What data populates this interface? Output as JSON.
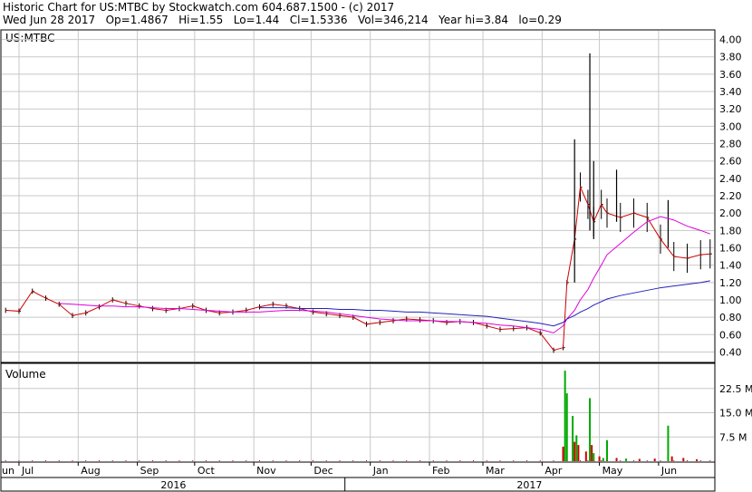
{
  "header": {
    "line1": "Historic Chart for US:MTBC by Stockwatch.com 604.687.1500 - (c) 2017",
    "line2": "Wed Jun 28 2017   Op=1.4867   Hi=1.55   Lo=1.44   Cl=1.5336   Vol=346,214   Year hi=3.84   lo=0.29"
  },
  "colors": {
    "price_bars": "#000000",
    "close_line": "#cc0000",
    "ma_short": "#dd00dd",
    "ma_long": "#2222bb",
    "volume_up": "#00aa00",
    "volume_down": "#cc0000",
    "grid": "#c8c8c8"
  },
  "chart_data": [
    {
      "type": "line",
      "title": "US:MTBC",
      "y_ticks": [
        "4.00",
        "3.80",
        "3.60",
        "3.40",
        "3.20",
        "3.00",
        "2.80",
        "2.60",
        "2.40",
        "2.20",
        "2.00",
        "1.80",
        "1.60",
        "1.40",
        "1.20",
        "1.00",
        "0.80",
        "0.60",
        "0.40"
      ],
      "ylim": [
        0.29,
        4.1
      ],
      "months": [
        "un",
        "Jul",
        "Aug",
        "Sep",
        "Oct",
        "Nov",
        "Dec",
        "Jan",
        "Feb",
        "Mar",
        "Apr",
        "May",
        "Jun"
      ],
      "years": [
        "2016",
        "2017"
      ],
      "grid": true,
      "x": [
        "2016-06-24",
        "2016-07-01",
        "2016-07-08",
        "2016-07-15",
        "2016-07-22",
        "2016-07-29",
        "2016-08-05",
        "2016-08-12",
        "2016-08-19",
        "2016-08-26",
        "2016-09-02",
        "2016-09-09",
        "2016-09-16",
        "2016-09-23",
        "2016-09-30",
        "2016-10-07",
        "2016-10-14",
        "2016-10-21",
        "2016-10-28",
        "2016-11-04",
        "2016-11-11",
        "2016-11-18",
        "2016-11-25",
        "2016-12-02",
        "2016-12-09",
        "2016-12-16",
        "2016-12-23",
        "2016-12-30",
        "2017-01-06",
        "2017-01-13",
        "2017-01-20",
        "2017-01-27",
        "2017-02-03",
        "2017-02-10",
        "2017-02-17",
        "2017-02-24",
        "2017-03-03",
        "2017-03-10",
        "2017-03-17",
        "2017-03-24",
        "2017-03-31",
        "2017-04-07",
        "2017-04-12",
        "2017-04-14",
        "2017-04-18",
        "2017-04-21",
        "2017-04-25",
        "2017-04-28",
        "2017-05-02",
        "2017-05-05",
        "2017-05-12",
        "2017-05-19",
        "2017-05-26",
        "2017-06-02",
        "2017-06-09",
        "2017-06-16",
        "2017-06-23",
        "2017-06-28"
      ],
      "series": [
        {
          "values": [
            0.88,
            0.87,
            1.1,
            1.02,
            0.95,
            0.82,
            0.85,
            0.92,
            1.0,
            0.96,
            0.93,
            0.9,
            0.88,
            0.9,
            0.93,
            0.88,
            0.85,
            0.86,
            0.88,
            0.92,
            0.95,
            0.93,
            0.9,
            0.86,
            0.84,
            0.82,
            0.8,
            0.72,
            0.74,
            0.76,
            0.78,
            0.77,
            0.76,
            0.74,
            0.75,
            0.74,
            0.7,
            0.66,
            0.67,
            0.68,
            0.62,
            0.42,
            0.45,
            1.2,
            1.7,
            2.3,
            2.1,
            1.9,
            2.1,
            2.0,
            1.95,
            2.0,
            1.95,
            1.7,
            1.5,
            1.48,
            1.52,
            1.53
          ]
        }
      ],
      "moving_averages": [
        {
          "values": [
            null,
            null,
            null,
            null,
            0.96,
            0.95,
            0.94,
            0.93,
            0.93,
            0.92,
            0.92,
            0.91,
            0.9,
            0.9,
            0.89,
            0.88,
            0.87,
            0.86,
            0.86,
            0.86,
            0.87,
            0.88,
            0.88,
            0.87,
            0.86,
            0.84,
            0.82,
            0.8,
            0.78,
            0.77,
            0.76,
            0.76,
            0.76,
            0.75,
            0.75,
            0.74,
            0.73,
            0.71,
            0.7,
            0.68,
            0.66,
            0.62,
            0.7,
            0.78,
            0.88,
            1.0,
            1.12,
            1.25,
            1.4,
            1.52,
            1.65,
            1.78,
            1.9,
            1.96,
            1.92,
            1.85,
            1.8,
            1.76
          ]
        },
        {
          "values": [
            null,
            null,
            null,
            null,
            null,
            null,
            null,
            null,
            null,
            null,
            null,
            null,
            null,
            null,
            null,
            null,
            null,
            null,
            null,
            0.91,
            0.91,
            0.91,
            0.9,
            0.9,
            0.9,
            0.89,
            0.89,
            0.88,
            0.88,
            0.87,
            0.86,
            0.86,
            0.85,
            0.84,
            0.83,
            0.82,
            0.81,
            0.79,
            0.77,
            0.75,
            0.73,
            0.7,
            0.74,
            0.78,
            0.82,
            0.86,
            0.9,
            0.94,
            0.98,
            1.01,
            1.05,
            1.08,
            1.11,
            1.14,
            1.16,
            1.18,
            1.2,
            1.22
          ]
        }
      ]
    },
    {
      "type": "bar",
      "title": "Volume",
      "y_ticks": [
        "22.5 M",
        "15.0 M",
        "7.5 M"
      ],
      "ylim": [
        0,
        30
      ],
      "bars": [
        {
          "x": "2017-04-12",
          "v": 4.5,
          "up": false
        },
        {
          "x": "2017-04-13",
          "v": 28.0,
          "up": true
        },
        {
          "x": "2017-04-14",
          "v": 21.0,
          "up": true
        },
        {
          "x": "2017-04-17",
          "v": 14.0,
          "up": true
        },
        {
          "x": "2017-04-18",
          "v": 6.0,
          "up": false
        },
        {
          "x": "2017-04-19",
          "v": 8.0,
          "up": true
        },
        {
          "x": "2017-04-20",
          "v": 5.0,
          "up": false
        },
        {
          "x": "2017-04-24",
          "v": 3.0,
          "up": false
        },
        {
          "x": "2017-04-26",
          "v": 19.5,
          "up": true
        },
        {
          "x": "2017-04-27",
          "v": 5.0,
          "up": false
        },
        {
          "x": "2017-04-28",
          "v": 2.5,
          "up": true
        },
        {
          "x": "2017-05-01",
          "v": 1.5,
          "up": false
        },
        {
          "x": "2017-05-03",
          "v": 1.0,
          "up": true
        },
        {
          "x": "2017-05-05",
          "v": 6.5,
          "up": true
        },
        {
          "x": "2017-05-10",
          "v": 1.0,
          "up": false
        },
        {
          "x": "2017-05-15",
          "v": 0.8,
          "up": true
        },
        {
          "x": "2017-05-22",
          "v": 0.7,
          "up": false
        },
        {
          "x": "2017-05-30",
          "v": 0.8,
          "up": false
        },
        {
          "x": "2017-06-06",
          "v": 11.0,
          "up": true
        },
        {
          "x": "2017-06-08",
          "v": 1.5,
          "up": false
        },
        {
          "x": "2017-06-14",
          "v": 1.0,
          "up": false
        },
        {
          "x": "2017-06-21",
          "v": 0.6,
          "up": false
        }
      ]
    }
  ]
}
